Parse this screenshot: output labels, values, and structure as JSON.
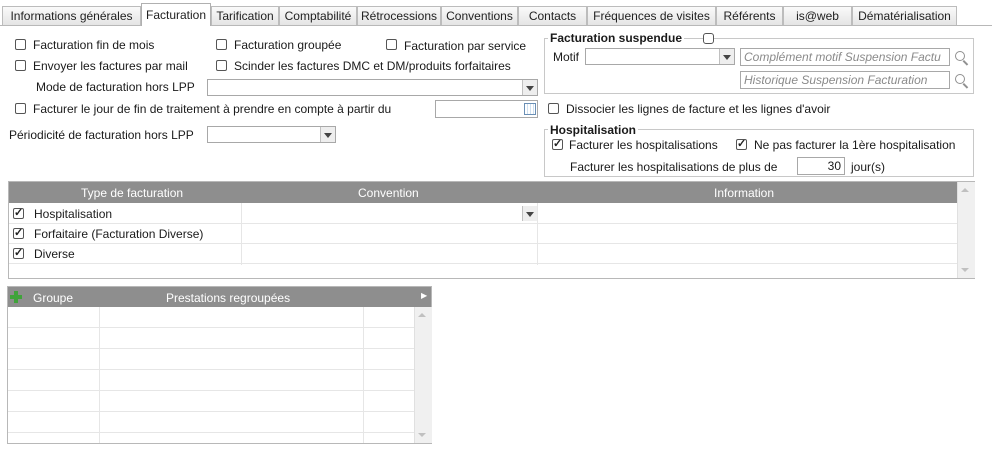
{
  "tabs": [
    {
      "label": "Informations générales"
    },
    {
      "label": "Facturation"
    },
    {
      "label": "Tarification"
    },
    {
      "label": "Comptabilité"
    },
    {
      "label": "Rétrocessions"
    },
    {
      "label": "Conventions"
    },
    {
      "label": "Contacts"
    },
    {
      "label": "Fréquences de visites"
    },
    {
      "label": "Référents"
    },
    {
      "label": "is@web"
    },
    {
      "label": "Dématérialisation"
    }
  ],
  "options": {
    "fin_mois": {
      "label": "Facturation fin de mois",
      "checked": false
    },
    "groupee": {
      "label": "Facturation groupée",
      "checked": false
    },
    "par_service": {
      "label": "Facturation par service",
      "checked": false
    },
    "par_mail": {
      "label": "Envoyer les factures par mail",
      "checked": false
    },
    "scinder": {
      "label": "Scinder les factures DMC et DM/produits forfaitaires",
      "checked": false
    },
    "mode_hors_lpp_label": "Mode de facturation hors LPP",
    "mode_hors_lpp_value": "",
    "fin_traitement": {
      "label": "Facturer le jour de fin de traitement  à prendre en compte à partir du",
      "checked": false
    },
    "fin_traitement_date": "",
    "periodicite_label": "Périodicité de facturation hors LPP",
    "periodicite_value": "",
    "dissocier": {
      "label": "Dissocier les lignes de facture et les lignes d'avoir",
      "checked": false
    }
  },
  "suspension": {
    "title": "Facturation suspendue",
    "checked": false,
    "motif_label": "Motif",
    "motif_value": "",
    "complement_placeholder": "Complément motif Suspension Factu",
    "historique_placeholder": "Historique Suspension Facturation"
  },
  "hospitalisation": {
    "title": "Hospitalisation",
    "facturer": {
      "label": "Facturer les hospitalisations",
      "checked": true
    },
    "ne_pas_facturer": {
      "label": "Ne pas facturer la 1ère hospitalisation",
      "checked": true
    },
    "plus_de_label": "Facturer les hospitalisations de plus de",
    "plus_de_value": "30",
    "jours_label": "jour(s)"
  },
  "type_grid": {
    "headers": [
      "Type de facturation",
      "Convention",
      "Information"
    ],
    "rows": [
      {
        "checked": true,
        "type": "Hospitalisation",
        "convention": "",
        "information": ""
      },
      {
        "checked": true,
        "type": "Forfaitaire (Facturation Diverse)",
        "convention": "",
        "information": ""
      },
      {
        "checked": true,
        "type": "Diverse",
        "convention": "",
        "information": ""
      }
    ]
  },
  "groupe_grid": {
    "headers": [
      "Groupe",
      "Prestations regroupées"
    ]
  },
  "icons": {
    "search": "magnifier-icon",
    "calendar": "calendar-icon",
    "add": "plus-icon"
  }
}
